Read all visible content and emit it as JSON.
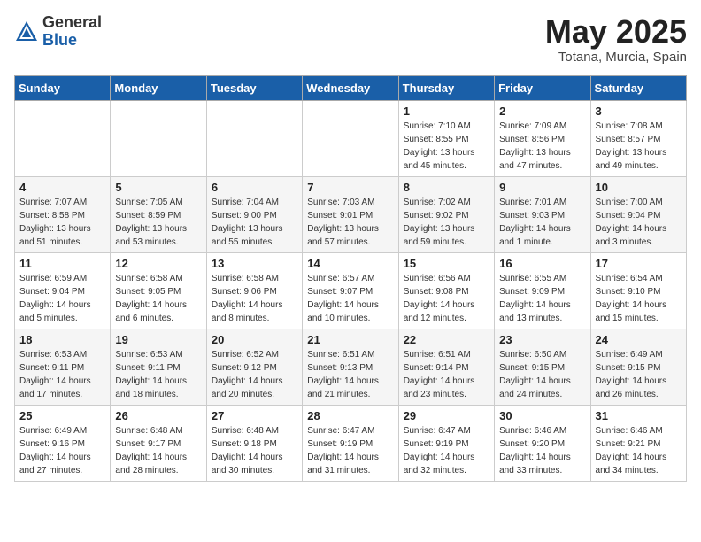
{
  "logo": {
    "general": "General",
    "blue": "Blue"
  },
  "title": "May 2025",
  "subtitle": "Totana, Murcia, Spain",
  "days_of_week": [
    "Sunday",
    "Monday",
    "Tuesday",
    "Wednesday",
    "Thursday",
    "Friday",
    "Saturday"
  ],
  "weeks": [
    [
      {
        "day": "",
        "sunrise": "",
        "sunset": "",
        "daylight": ""
      },
      {
        "day": "",
        "sunrise": "",
        "sunset": "",
        "daylight": ""
      },
      {
        "day": "",
        "sunrise": "",
        "sunset": "",
        "daylight": ""
      },
      {
        "day": "",
        "sunrise": "",
        "sunset": "",
        "daylight": ""
      },
      {
        "day": "1",
        "sunrise": "Sunrise: 7:10 AM",
        "sunset": "Sunset: 8:55 PM",
        "daylight": "Daylight: 13 hours and 45 minutes."
      },
      {
        "day": "2",
        "sunrise": "Sunrise: 7:09 AM",
        "sunset": "Sunset: 8:56 PM",
        "daylight": "Daylight: 13 hours and 47 minutes."
      },
      {
        "day": "3",
        "sunrise": "Sunrise: 7:08 AM",
        "sunset": "Sunset: 8:57 PM",
        "daylight": "Daylight: 13 hours and 49 minutes."
      }
    ],
    [
      {
        "day": "4",
        "sunrise": "Sunrise: 7:07 AM",
        "sunset": "Sunset: 8:58 PM",
        "daylight": "Daylight: 13 hours and 51 minutes."
      },
      {
        "day": "5",
        "sunrise": "Sunrise: 7:05 AM",
        "sunset": "Sunset: 8:59 PM",
        "daylight": "Daylight: 13 hours and 53 minutes."
      },
      {
        "day": "6",
        "sunrise": "Sunrise: 7:04 AM",
        "sunset": "Sunset: 9:00 PM",
        "daylight": "Daylight: 13 hours and 55 minutes."
      },
      {
        "day": "7",
        "sunrise": "Sunrise: 7:03 AM",
        "sunset": "Sunset: 9:01 PM",
        "daylight": "Daylight: 13 hours and 57 minutes."
      },
      {
        "day": "8",
        "sunrise": "Sunrise: 7:02 AM",
        "sunset": "Sunset: 9:02 PM",
        "daylight": "Daylight: 13 hours and 59 minutes."
      },
      {
        "day": "9",
        "sunrise": "Sunrise: 7:01 AM",
        "sunset": "Sunset: 9:03 PM",
        "daylight": "Daylight: 14 hours and 1 minute."
      },
      {
        "day": "10",
        "sunrise": "Sunrise: 7:00 AM",
        "sunset": "Sunset: 9:04 PM",
        "daylight": "Daylight: 14 hours and 3 minutes."
      }
    ],
    [
      {
        "day": "11",
        "sunrise": "Sunrise: 6:59 AM",
        "sunset": "Sunset: 9:04 PM",
        "daylight": "Daylight: 14 hours and 5 minutes."
      },
      {
        "day": "12",
        "sunrise": "Sunrise: 6:58 AM",
        "sunset": "Sunset: 9:05 PM",
        "daylight": "Daylight: 14 hours and 6 minutes."
      },
      {
        "day": "13",
        "sunrise": "Sunrise: 6:58 AM",
        "sunset": "Sunset: 9:06 PM",
        "daylight": "Daylight: 14 hours and 8 minutes."
      },
      {
        "day": "14",
        "sunrise": "Sunrise: 6:57 AM",
        "sunset": "Sunset: 9:07 PM",
        "daylight": "Daylight: 14 hours and 10 minutes."
      },
      {
        "day": "15",
        "sunrise": "Sunrise: 6:56 AM",
        "sunset": "Sunset: 9:08 PM",
        "daylight": "Daylight: 14 hours and 12 minutes."
      },
      {
        "day": "16",
        "sunrise": "Sunrise: 6:55 AM",
        "sunset": "Sunset: 9:09 PM",
        "daylight": "Daylight: 14 hours and 13 minutes."
      },
      {
        "day": "17",
        "sunrise": "Sunrise: 6:54 AM",
        "sunset": "Sunset: 9:10 PM",
        "daylight": "Daylight: 14 hours and 15 minutes."
      }
    ],
    [
      {
        "day": "18",
        "sunrise": "Sunrise: 6:53 AM",
        "sunset": "Sunset: 9:11 PM",
        "daylight": "Daylight: 14 hours and 17 minutes."
      },
      {
        "day": "19",
        "sunrise": "Sunrise: 6:53 AM",
        "sunset": "Sunset: 9:11 PM",
        "daylight": "Daylight: 14 hours and 18 minutes."
      },
      {
        "day": "20",
        "sunrise": "Sunrise: 6:52 AM",
        "sunset": "Sunset: 9:12 PM",
        "daylight": "Daylight: 14 hours and 20 minutes."
      },
      {
        "day": "21",
        "sunrise": "Sunrise: 6:51 AM",
        "sunset": "Sunset: 9:13 PM",
        "daylight": "Daylight: 14 hours and 21 minutes."
      },
      {
        "day": "22",
        "sunrise": "Sunrise: 6:51 AM",
        "sunset": "Sunset: 9:14 PM",
        "daylight": "Daylight: 14 hours and 23 minutes."
      },
      {
        "day": "23",
        "sunrise": "Sunrise: 6:50 AM",
        "sunset": "Sunset: 9:15 PM",
        "daylight": "Daylight: 14 hours and 24 minutes."
      },
      {
        "day": "24",
        "sunrise": "Sunrise: 6:49 AM",
        "sunset": "Sunset: 9:15 PM",
        "daylight": "Daylight: 14 hours and 26 minutes."
      }
    ],
    [
      {
        "day": "25",
        "sunrise": "Sunrise: 6:49 AM",
        "sunset": "Sunset: 9:16 PM",
        "daylight": "Daylight: 14 hours and 27 minutes."
      },
      {
        "day": "26",
        "sunrise": "Sunrise: 6:48 AM",
        "sunset": "Sunset: 9:17 PM",
        "daylight": "Daylight: 14 hours and 28 minutes."
      },
      {
        "day": "27",
        "sunrise": "Sunrise: 6:48 AM",
        "sunset": "Sunset: 9:18 PM",
        "daylight": "Daylight: 14 hours and 30 minutes."
      },
      {
        "day": "28",
        "sunrise": "Sunrise: 6:47 AM",
        "sunset": "Sunset: 9:19 PM",
        "daylight": "Daylight: 14 hours and 31 minutes."
      },
      {
        "day": "29",
        "sunrise": "Sunrise: 6:47 AM",
        "sunset": "Sunset: 9:19 PM",
        "daylight": "Daylight: 14 hours and 32 minutes."
      },
      {
        "day": "30",
        "sunrise": "Sunrise: 6:46 AM",
        "sunset": "Sunset: 9:20 PM",
        "daylight": "Daylight: 14 hours and 33 minutes."
      },
      {
        "day": "31",
        "sunrise": "Sunrise: 6:46 AM",
        "sunset": "Sunset: 9:21 PM",
        "daylight": "Daylight: 14 hours and 34 minutes."
      }
    ]
  ]
}
